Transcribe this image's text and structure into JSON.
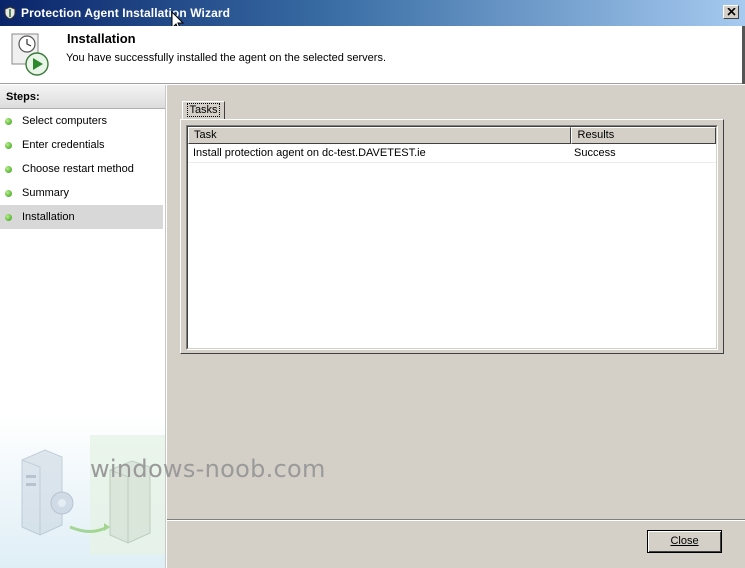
{
  "window": {
    "title": "Protection Agent Installation Wizard",
    "close_icon": "close-icon"
  },
  "header": {
    "title": "Installation",
    "subtitle": "You have successfully installed the agent on the selected servers."
  },
  "sidebar": {
    "title": "Steps:",
    "steps": [
      {
        "label": "Select computers",
        "active": false
      },
      {
        "label": "Enter credentials",
        "active": false
      },
      {
        "label": "Choose restart method",
        "active": false
      },
      {
        "label": "Summary",
        "active": false
      },
      {
        "label": "Installation",
        "active": true
      }
    ]
  },
  "tasks": {
    "tab_label": "Tasks",
    "columns": [
      "Task",
      "Results"
    ],
    "rows": [
      {
        "task": "Install protection agent on dc-test.DAVETEST.ie",
        "result": "Success"
      }
    ]
  },
  "footer": {
    "close_label": "Close",
    "watermark": "windows-noob.com"
  },
  "colors": {
    "title_bar_start": "#0a246a",
    "title_bar_end": "#a6caf0",
    "dialog_face": "#d4d0c8",
    "step_dot": "#2e9a10"
  }
}
